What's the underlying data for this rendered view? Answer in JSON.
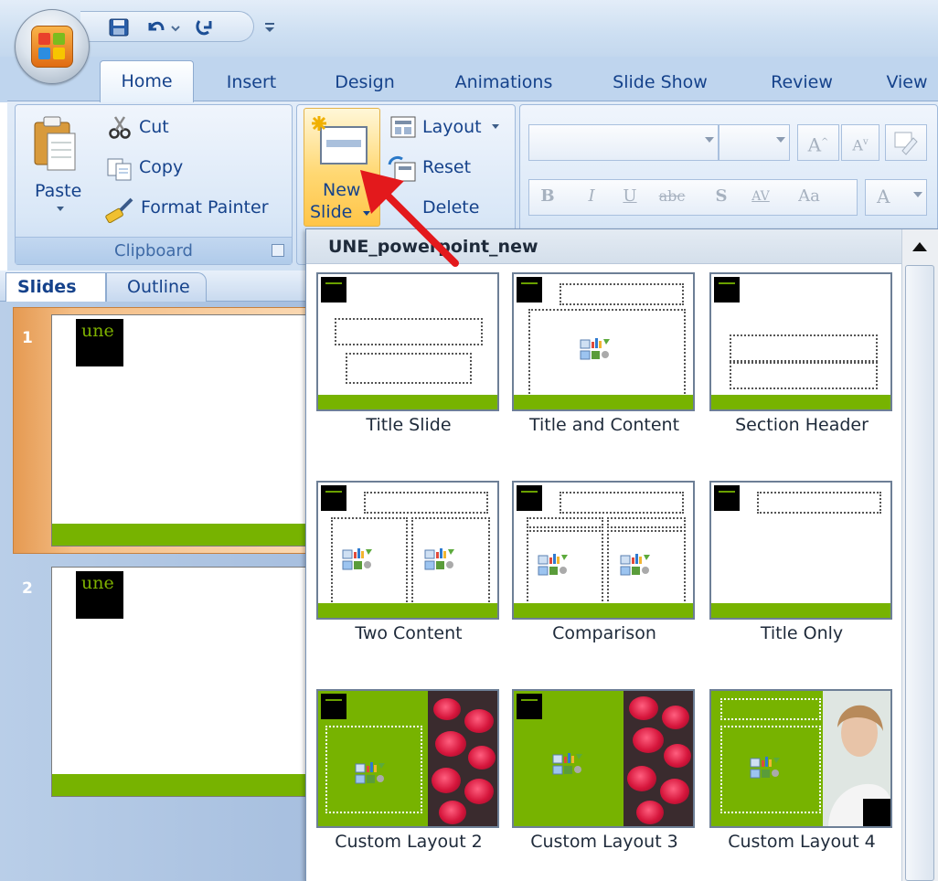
{
  "quick_access": {
    "icons": [
      "save-icon",
      "undo-icon",
      "redo-icon",
      "customize-icon"
    ]
  },
  "tabs": [
    "Home",
    "Insert",
    "Design",
    "Animations",
    "Slide Show",
    "Review",
    "View"
  ],
  "clipboard": {
    "paste": "Paste",
    "cut": "Cut",
    "copy": "Copy",
    "format_painter": "Format Painter",
    "group_label": "Clipboard"
  },
  "slides_group": {
    "new_slide_line1": "New",
    "new_slide_line2": "Slide",
    "layout": "Layout",
    "reset": "Reset",
    "delete": "Delete"
  },
  "font_group": {
    "bold": "B",
    "italic": "I",
    "underline": "U",
    "strike": "abc",
    "shadow": "S",
    "spacing": "AV",
    "change_case": "Aa",
    "font_color": "A"
  },
  "left_panel": {
    "tab_slides": "Slides",
    "tab_outline": "Outline",
    "slide_numbers": [
      "1",
      "2"
    ],
    "thumb_logo": "une"
  },
  "gallery": {
    "title": "UNE_powerpoint_new",
    "layouts": [
      "Title Slide",
      "Title and Content",
      "Section Header",
      "Two Content",
      "Comparison",
      "Title Only",
      "Custom Layout 2",
      "Custom Layout 3",
      "Custom Layout 4"
    ]
  },
  "colors": {
    "ribbon_blue": "#bfd5ee",
    "slide_green": "#77b300",
    "selection_orange": "#f4be86",
    "arrow_red": "#e3191c"
  }
}
